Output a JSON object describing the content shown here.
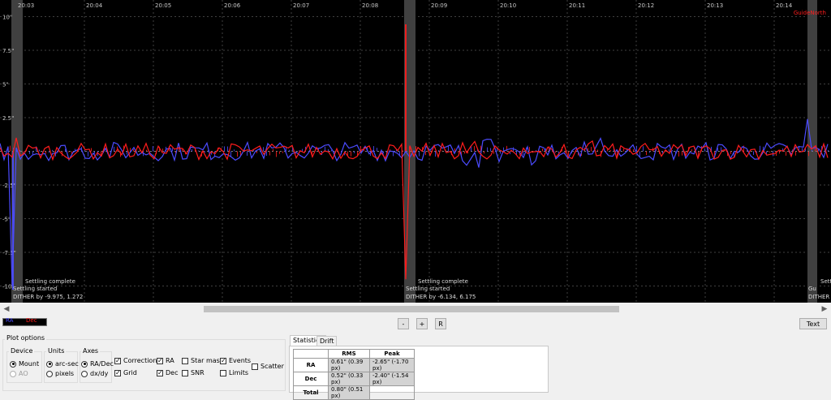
{
  "graph": {
    "time_labels": [
      "20:03",
      "20:04",
      "20:05",
      "20:06",
      "20:07",
      "20:08",
      "20:09",
      "20:10",
      "20:11",
      "20:12",
      "20:13",
      "20:14"
    ],
    "y_labels": [
      "10\"",
      "7.5\"",
      "5\"",
      "2.5\"",
      "-2.5\"",
      "-5\"",
      "-7.5\"",
      "-10\""
    ],
    "corner_label": "GuideNorth",
    "events": [
      {
        "settling_complete": "Settling complete",
        "settling_started": "Settling started",
        "dither": "DITHER by -9.975, 1.272"
      },
      {
        "settling_complete": "Settling complete",
        "settling_started": "Settling started",
        "dither": "DITHER by -6.134, 6.175"
      },
      {
        "settling_complete": "Settling",
        "settling_started": "Gu",
        "dither": "DITHER"
      }
    ],
    "colors": {
      "ra": "#4b4bff",
      "dec": "#ff1c1c",
      "background": "#000000",
      "grid": "#404040",
      "dither_band": "#555555"
    }
  },
  "legend": {
    "ra": "RA",
    "dec": "Dec"
  },
  "controls": {
    "minus": "-",
    "plus": "+",
    "reset": "R",
    "text": "Text"
  },
  "plot_options": {
    "title": "Plot options",
    "device": {
      "title": "Device",
      "mount": "Mount",
      "ao": "AO"
    },
    "units": {
      "title": "Units",
      "arcsec": "arc-sec",
      "pixels": "pixels"
    },
    "axes": {
      "title": "Axes",
      "radec": "RA/Dec",
      "dxdy": "dx/dy"
    },
    "checks": {
      "corrections": "Corrections",
      "grid": "Grid",
      "ra": "RA",
      "dec": "Dec",
      "star_mass": "Star mass",
      "snr": "SNR",
      "events": "Events",
      "limits": "Limits",
      "scatter": "Scatter"
    }
  },
  "tabs": {
    "statistics": "Statistics",
    "drift": "Drift"
  },
  "stats": {
    "headers": [
      "",
      "RMS",
      "Peak"
    ],
    "rows": [
      {
        "label": "RA",
        "rms": "0.61\" (0.39 px)",
        "peak": "-2.65\" (-1.70 px)"
      },
      {
        "label": "Dec",
        "rms": "0.52\" (0.33 px)",
        "peak": "-2.40\" (-1.54 px)"
      },
      {
        "label": "Total",
        "rms": "0.80\" (0.51 px)",
        "peak": ""
      }
    ]
  }
}
